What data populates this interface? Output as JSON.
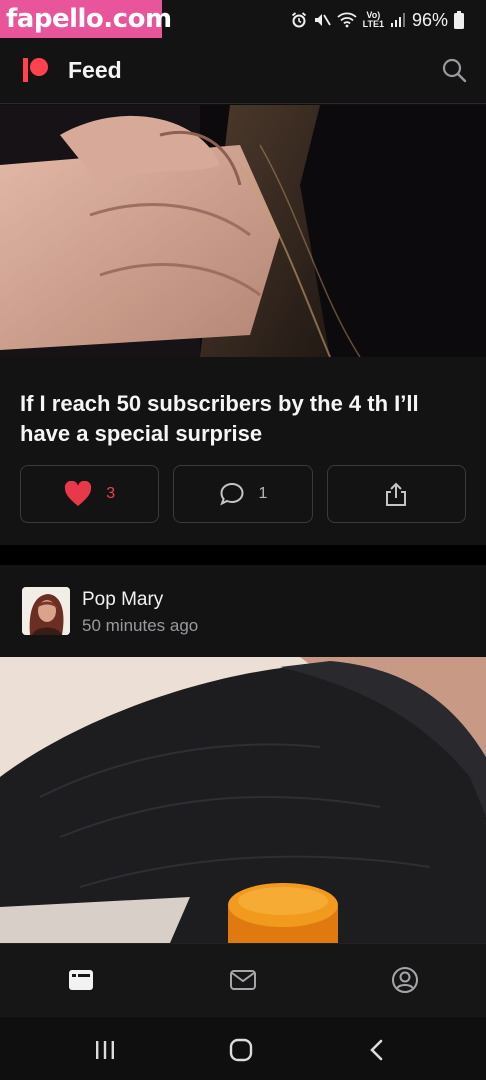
{
  "watermark": "fapello.com",
  "status_bar": {
    "battery": "96%",
    "network_top": "Vo)",
    "network_bottom": "LTE1",
    "icons": [
      "alarm-icon",
      "mute-icon",
      "wifi-icon",
      "signal-icon",
      "battery-icon"
    ]
  },
  "header": {
    "title": "Feed",
    "logo_color": "#ff424d"
  },
  "post1": {
    "title": "If I reach 50 subscribers by the 4 th I’ll have a special surprise",
    "likes": "3",
    "comments": "1"
  },
  "post2": {
    "author": "Pop Mary",
    "time": "50 minutes ago"
  },
  "bottom_nav": {
    "items": [
      "feed-icon",
      "mail-icon",
      "profile-icon"
    ]
  },
  "colors": {
    "accent": "#ff424d",
    "background": "#131314",
    "border": "#3a3a3d"
  }
}
